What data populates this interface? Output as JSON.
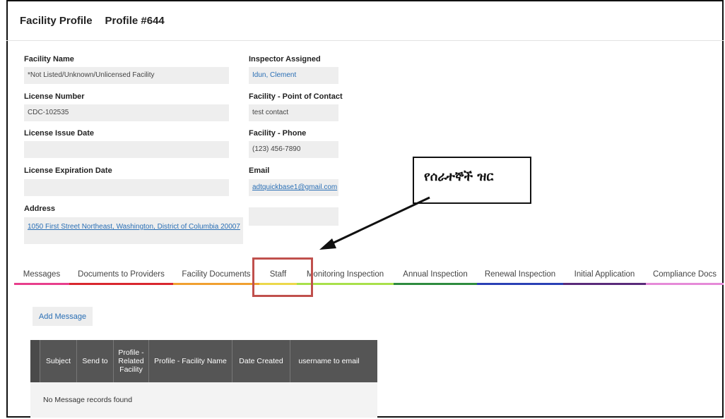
{
  "header": {
    "title": "Facility Profile",
    "profile_number": "Profile #644"
  },
  "fields": {
    "facility_name": {
      "label": "Facility Name",
      "value": "*Not Listed/Unknown/Unlicensed Facility"
    },
    "license_number": {
      "label": "License Number",
      "value": "CDC-102535"
    },
    "license_issue_date": {
      "label": "License Issue Date",
      "value": ""
    },
    "license_expiration_date": {
      "label": "License Expiration Date",
      "value": ""
    },
    "address": {
      "label": "Address",
      "value": "1050 First Street Northeast, Washington, District of Columbia 20007"
    },
    "inspector_assigned": {
      "label": "Inspector Assigned",
      "value": "Idun, Clement"
    },
    "point_of_contact": {
      "label": "Facility - Point of Contact",
      "value": "test contact"
    },
    "phone": {
      "label": "Facility - Phone",
      "value": "(123) 456-7890"
    },
    "email": {
      "label": "Email",
      "value": "adtquickbase1@gmail.com"
    }
  },
  "tabs": [
    {
      "label": "Messages",
      "color": "#e83e8c"
    },
    {
      "label": "Documents to Providers",
      "color": "#d9262e"
    },
    {
      "label": "Facility Documents",
      "color": "#f0a030"
    },
    {
      "label": "Staff",
      "color": "#ecd84a"
    },
    {
      "label": "Monitoring Inspection",
      "color": "#a8e04a"
    },
    {
      "label": "Annual Inspection",
      "color": "#2e8b3e"
    },
    {
      "label": "Renewal Inspection",
      "color": "#2a3fb5"
    },
    {
      "label": "Initial Application",
      "color": "#5a2a7a"
    },
    {
      "label": "Compliance Docs",
      "color": "#e68ad8"
    }
  ],
  "callout": {
    "text": "የሰራተኞች ዝር"
  },
  "add_message_label": "Add Message",
  "table": {
    "columns": [
      "Subject",
      "Send to",
      "Profile - Related Facility",
      "Profile - Facility Name",
      "Date Created",
      "username to email"
    ],
    "empty_text": "No Message records found"
  },
  "colors": {
    "highlight": "#c0504d",
    "link": "#2a6fb5",
    "table_header": "#555555"
  }
}
